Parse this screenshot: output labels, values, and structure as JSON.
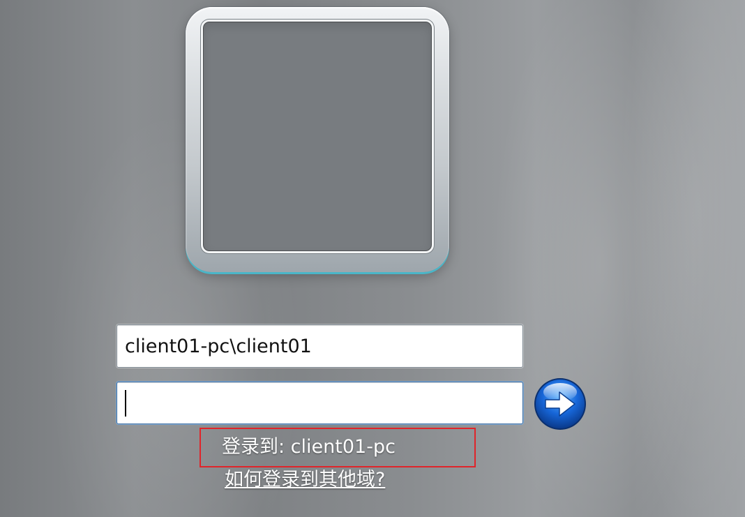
{
  "login": {
    "username_value": "client01-pc\\client01",
    "password_value": "",
    "logon_to": "登录到: client01-pc",
    "other_domain_link": "如何登录到其他域?",
    "submit_icon": "arrow-right-icon",
    "highlight_color": "#e0242a"
  }
}
